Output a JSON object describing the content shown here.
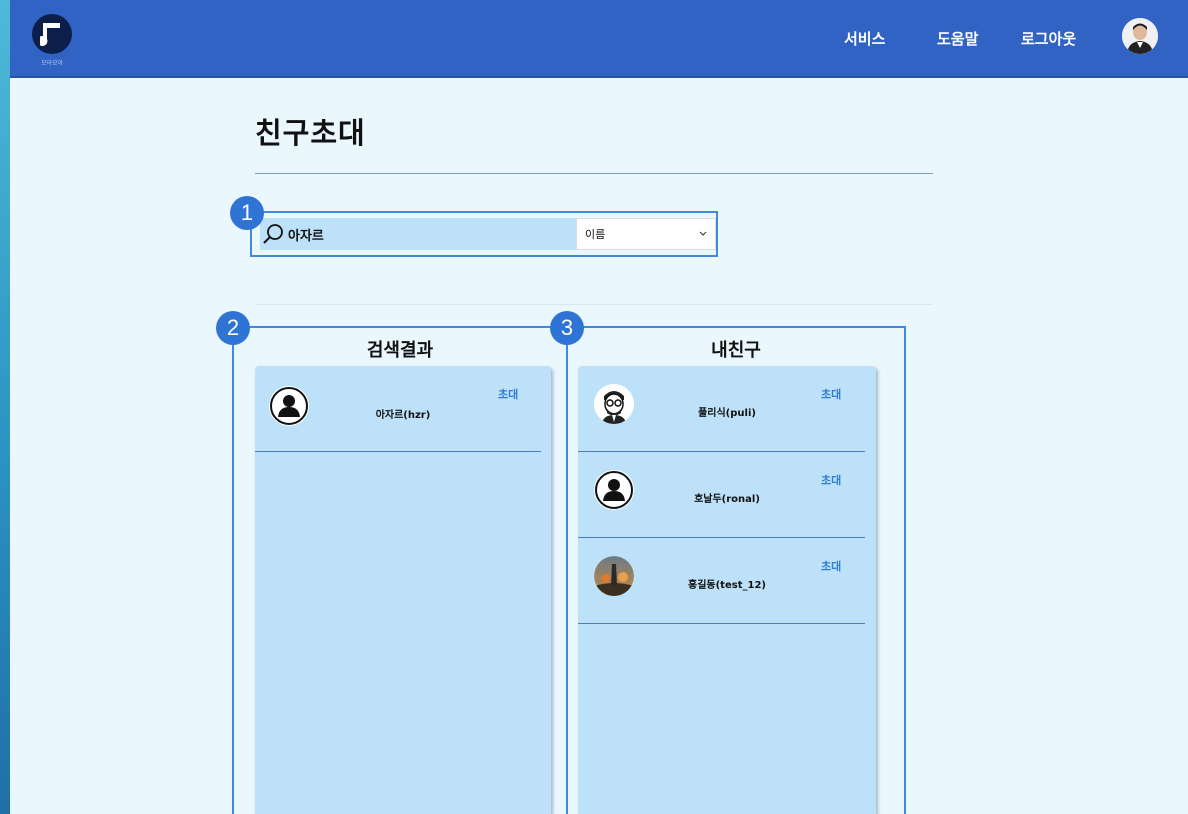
{
  "header": {
    "logo_caption": "모아모아",
    "nav": [
      "서비스",
      "도움말",
      "로그아웃"
    ]
  },
  "page": {
    "title": "친구초대"
  },
  "search": {
    "badge": "1",
    "value": "아자르",
    "select_value": "이름"
  },
  "results": {
    "badge": "2",
    "title": "검색결과",
    "items": [
      {
        "name": "아자르(hzr)",
        "action": "초대",
        "avatar": "default-user-icon"
      }
    ]
  },
  "friends": {
    "badge": "3",
    "title": "내친구",
    "items": [
      {
        "name": "풀리식(puli)",
        "action": "초대",
        "avatar": "glasses-man-avatar"
      },
      {
        "name": "호날두(ronal)",
        "action": "초대",
        "avatar": "default-user-icon"
      },
      {
        "name": "홍길동(test_12)",
        "action": "초대",
        "avatar": "game-scene-avatar"
      }
    ]
  },
  "colors": {
    "header": "#3163c5",
    "accent": "#3f8bd9",
    "card": "#bde1f8",
    "invite": "#2f7dd6"
  }
}
